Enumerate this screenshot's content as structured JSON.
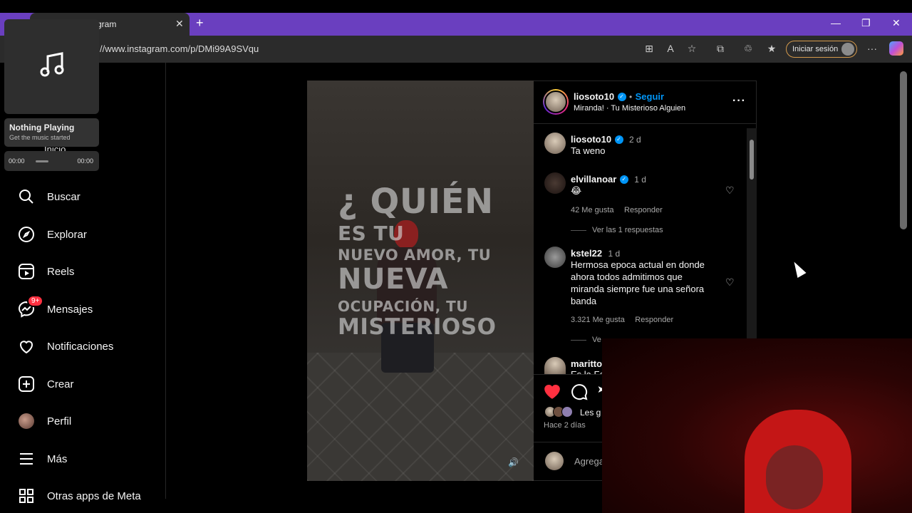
{
  "browser": {
    "tab_title": "gram",
    "tab_close": "✕",
    "new_tab": "+",
    "url": "//www.instagram.com/p/DMi99A9SVqu",
    "sign_in_label": "Iniciar sesión",
    "menu_label": "···"
  },
  "media_player": {
    "title": "Nothing Playing",
    "subtitle": "Get the music started",
    "time_start": "00:00",
    "time_end": "00:00",
    "hidden_item": "Inicio"
  },
  "sidebar": {
    "items": [
      {
        "label": "Buscar",
        "icon": "search-icon"
      },
      {
        "label": "Explorar",
        "icon": "compass-icon"
      },
      {
        "label": "Reels",
        "icon": "reels-icon"
      },
      {
        "label": "Mensajes",
        "icon": "messenger-icon",
        "badge": "9+"
      },
      {
        "label": "Notificaciones",
        "icon": "heart-icon"
      },
      {
        "label": "Crear",
        "icon": "plus-square-icon"
      },
      {
        "label": "Perfil",
        "icon": "profile-avatar"
      },
      {
        "label": "Más",
        "icon": "menu-icon"
      },
      {
        "label": "Otras apps de Meta",
        "icon": "apps-grid-icon"
      }
    ]
  },
  "post": {
    "author": "liosoto10",
    "follow_separator": "•",
    "follow_label": "Seguir",
    "audio": "Miranda! · Tu Misterioso Alguien",
    "more_label": "···",
    "overlay_lines": [
      "¿ QUIÉN",
      "ES TU",
      "NUEVO AMOR, TU",
      "NUEVA",
      "OCUPACIÓN, TU",
      "MISTERIOSO"
    ],
    "likes_preview": "Les g",
    "time_ago": "Hace 2 días",
    "add_comment_placeholder": "Agrega",
    "comments": [
      {
        "user": "liosoto10",
        "verified": true,
        "time": "2 d",
        "text": "Ta weno"
      },
      {
        "user": "elvillanoar",
        "verified": true,
        "time": "1 d",
        "text": "😂",
        "likes": "42 Me gusta",
        "reply": "Responder",
        "view_replies": "Ver las 1 respuestas"
      },
      {
        "user": "kstel22",
        "verified": false,
        "time": "1 d",
        "text_lines": [
          "Hermosa epoca actual en donde",
          "ahora todos admitimos que",
          "miranda siempre fue una señora",
          "banda"
        ],
        "likes": "3.321 Me gusta",
        "reply": "Responder",
        "view_replies": "Ve"
      },
      {
        "user": "maritto",
        "verified": false,
        "time": "",
        "text": "Es la Fa"
      }
    ]
  }
}
